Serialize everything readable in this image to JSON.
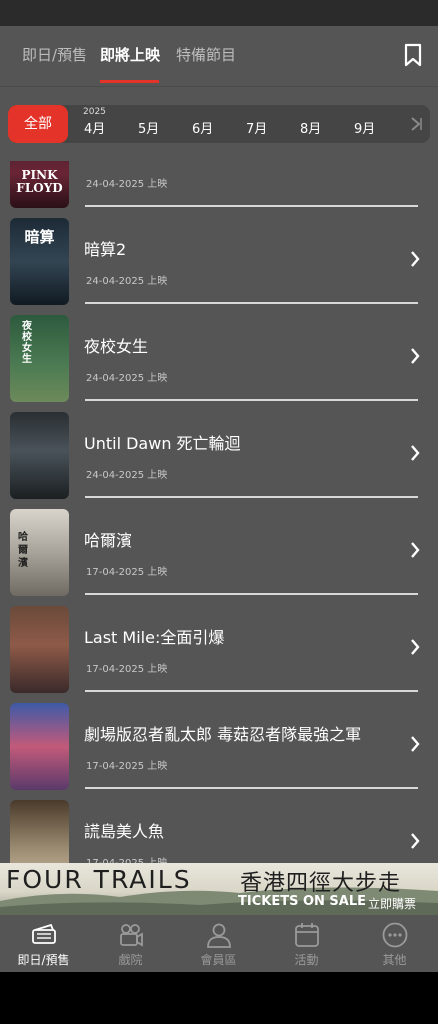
{
  "tabs": [
    {
      "label": "即日/預售",
      "active": false
    },
    {
      "label": "即將上映",
      "active": true
    },
    {
      "label": "特備節目",
      "active": false
    }
  ],
  "month_filter": {
    "all_label": "全部",
    "year": "2025",
    "months": [
      "4月",
      "5月",
      "6月",
      "7月",
      "8月",
      "9月"
    ]
  },
  "movies": [
    {
      "title": "",
      "date": "24-04-2025 上映",
      "poster_text": "PINK FLOYD"
    },
    {
      "title": "暗算2",
      "date": "24-04-2025 上映",
      "poster_text": "暗算"
    },
    {
      "title": "夜校女生",
      "date": "24-04-2025 上映",
      "poster_text": "夜校女生"
    },
    {
      "title": "Until Dawn 死亡輪迴",
      "date": "24-04-2025 上映",
      "poster_text": ""
    },
    {
      "title": "哈爾濱",
      "date": "17-04-2025 上映",
      "poster_text": "哈爾濱"
    },
    {
      "title": "Last Mile:全面引爆",
      "date": "17-04-2025 上映",
      "poster_text": ""
    },
    {
      "title": "劇場版忍者亂太郎 毒菇忍者隊最強之軍",
      "date": "17-04-2025 上映",
      "poster_text": ""
    },
    {
      "title": "謊島美人魚",
      "date": "17-04-2025 上映",
      "poster_text": ""
    }
  ],
  "ad": {
    "brand": "FOUR TRAILS",
    "chinese": "香港四徑大步走",
    "sale": "TICKETS ON SALE",
    "buy": "立即購票"
  },
  "bottom_nav": [
    {
      "label": "即日/預售",
      "icon": "ticket-icon",
      "active": true
    },
    {
      "label": "戲院",
      "icon": "camera-icon",
      "active": false
    },
    {
      "label": "會員區",
      "icon": "person-icon",
      "active": false
    },
    {
      "label": "活動",
      "icon": "calendar-icon",
      "active": false
    },
    {
      "label": "其他",
      "icon": "more-icon",
      "active": false
    }
  ],
  "colors": {
    "accent": "#e4342a",
    "background": "#555555",
    "month_bar": "#454545"
  }
}
